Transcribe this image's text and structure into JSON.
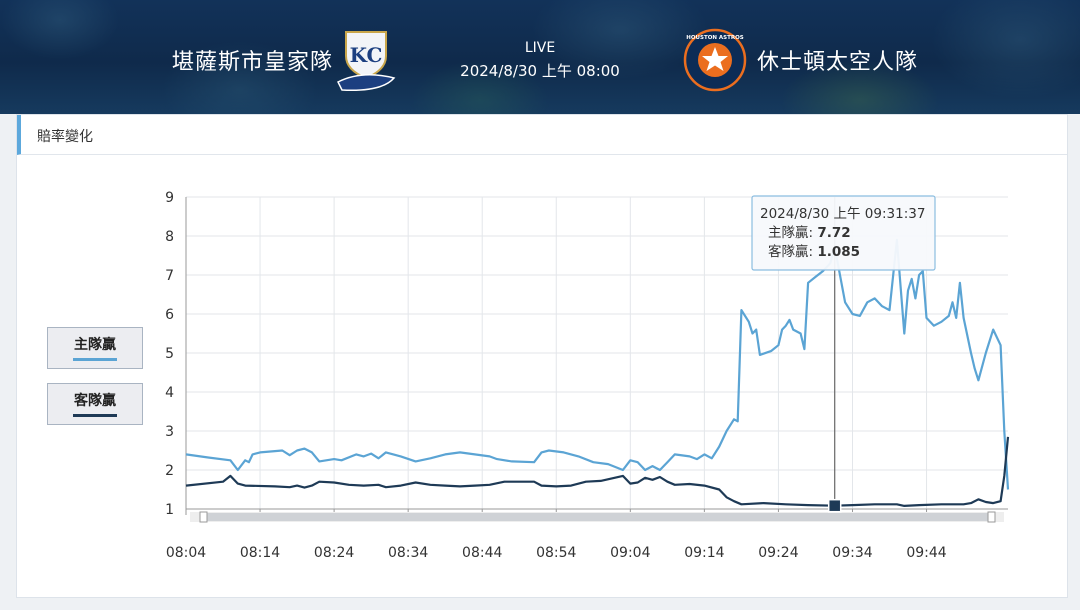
{
  "header": {
    "home_team": "堪薩斯市皇家隊",
    "away_team": "休士頓太空人隊",
    "status": "LIVE",
    "datetime": "2024/8/30 上午 08:00",
    "home_logo_text": "KC",
    "away_logo_text": "HOUSTON ASTROS"
  },
  "panel": {
    "title": "賠率變化"
  },
  "legend": [
    {
      "label": "主隊贏",
      "color": "#5ba4d4"
    },
    {
      "label": "客隊贏",
      "color": "#1e3a56"
    }
  ],
  "tooltip": {
    "time": "2024/8/30 上午 09:31:37",
    "home_label": "主隊贏",
    "home_value": "7.72",
    "away_label": "客隊贏",
    "away_value": "1.085"
  },
  "chart_data": {
    "type": "line",
    "title": "",
    "xlabel": "",
    "ylabel": "",
    "ylim": [
      1,
      9
    ],
    "yticks": [
      1,
      2,
      3,
      4,
      5,
      6,
      7,
      8,
      9
    ],
    "xticks": [
      "08:04",
      "08:14",
      "08:24",
      "08:34",
      "08:44",
      "08:54",
      "09:04",
      "09:14",
      "09:24",
      "09:34",
      "09:44"
    ],
    "grid": true,
    "legend_position": "left",
    "crosshair_time": "09:31.6",
    "series": [
      {
        "name": "主隊贏",
        "color": "#5ba4d4",
        "points": [
          [
            "08:04",
            2.4
          ],
          [
            "08:07",
            2.32
          ],
          [
            "08:10",
            2.25
          ],
          [
            "08:11",
            2.0
          ],
          [
            "08:12",
            2.25
          ],
          [
            "08:12.5",
            2.2
          ],
          [
            "08:13",
            2.4
          ],
          [
            "08:14",
            2.45
          ],
          [
            "08:17",
            2.5
          ],
          [
            "08:18",
            2.38
          ],
          [
            "08:19",
            2.5
          ],
          [
            "08:20",
            2.55
          ],
          [
            "08:21",
            2.45
          ],
          [
            "08:22",
            2.22
          ],
          [
            "08:24",
            2.28
          ],
          [
            "08:25",
            2.25
          ],
          [
            "08:27",
            2.4
          ],
          [
            "08:28",
            2.35
          ],
          [
            "08:29",
            2.42
          ],
          [
            "08:30",
            2.3
          ],
          [
            "08:31",
            2.45
          ],
          [
            "08:32",
            2.4
          ],
          [
            "08:33",
            2.35
          ],
          [
            "08:35",
            2.22
          ],
          [
            "08:37",
            2.3
          ],
          [
            "08:39",
            2.4
          ],
          [
            "08:41",
            2.45
          ],
          [
            "08:43",
            2.4
          ],
          [
            "08:45",
            2.35
          ],
          [
            "08:46",
            2.28
          ],
          [
            "08:48",
            2.22
          ],
          [
            "08:51",
            2.2
          ],
          [
            "08:52",
            2.45
          ],
          [
            "08:53",
            2.5
          ],
          [
            "08:55",
            2.45
          ],
          [
            "08:57",
            2.35
          ],
          [
            "08:59",
            2.2
          ],
          [
            "09:01",
            2.15
          ],
          [
            "09:03",
            2.0
          ],
          [
            "09:04",
            2.25
          ],
          [
            "09:05",
            2.2
          ],
          [
            "09:06",
            2.0
          ],
          [
            "09:07",
            2.1
          ],
          [
            "09:08",
            2.0
          ],
          [
            "09:09",
            2.2
          ],
          [
            "09:10",
            2.4
          ],
          [
            "09:12",
            2.35
          ],
          [
            "09:13",
            2.28
          ],
          [
            "09:14",
            2.4
          ],
          [
            "09:15",
            2.3
          ],
          [
            "09:16",
            2.6
          ],
          [
            "09:17",
            3.0
          ],
          [
            "09:18",
            3.3
          ],
          [
            "09:18.5",
            3.25
          ],
          [
            "09:19",
            6.1
          ],
          [
            "09:20",
            5.8
          ],
          [
            "09:20.5",
            5.5
          ],
          [
            "09:21",
            5.6
          ],
          [
            "09:21.5",
            4.95
          ],
          [
            "09:23",
            5.05
          ],
          [
            "09:24",
            5.2
          ],
          [
            "09:24.5",
            5.6
          ],
          [
            "09:25",
            5.7
          ],
          [
            "09:25.5",
            5.85
          ],
          [
            "09:26",
            5.6
          ],
          [
            "09:27",
            5.5
          ],
          [
            "09:27.5",
            5.1
          ],
          [
            "09:28",
            6.8
          ],
          [
            "09:29",
            6.95
          ],
          [
            "09:30",
            7.1
          ],
          [
            "09:31",
            7.3
          ],
          [
            "09:31.6",
            7.72
          ],
          [
            "09:33",
            6.3
          ],
          [
            "09:34",
            6.0
          ],
          [
            "09:35",
            5.95
          ],
          [
            "09:36",
            6.3
          ],
          [
            "09:37",
            6.4
          ],
          [
            "09:38",
            6.2
          ],
          [
            "09:39",
            6.1
          ],
          [
            "09:40",
            7.9
          ],
          [
            "09:41",
            5.5
          ],
          [
            "09:41.5",
            6.6
          ],
          [
            "09:42",
            6.9
          ],
          [
            "09:42.5",
            6.4
          ],
          [
            "09:43",
            7.0
          ],
          [
            "09:43.5",
            7.1
          ],
          [
            "09:44",
            5.9
          ],
          [
            "09:45",
            5.7
          ],
          [
            "09:46",
            5.8
          ],
          [
            "09:47",
            5.95
          ],
          [
            "09:47.5",
            6.3
          ],
          [
            "09:48",
            5.9
          ],
          [
            "09:48.5",
            6.8
          ],
          [
            "09:49",
            5.9
          ],
          [
            "09:50",
            5.0
          ],
          [
            "09:50.5",
            4.6
          ],
          [
            "09:51",
            4.3
          ],
          [
            "09:52",
            5.0
          ],
          [
            "09:53",
            5.6
          ],
          [
            "09:54",
            5.2
          ],
          [
            "09:54.5",
            3.0
          ],
          [
            "09:55",
            1.5
          ]
        ]
      },
      {
        "name": "客隊贏",
        "color": "#1e3a56",
        "points": [
          [
            "08:04",
            1.6
          ],
          [
            "08:09",
            1.7
          ],
          [
            "08:10",
            1.85
          ],
          [
            "08:11",
            1.65
          ],
          [
            "08:12",
            1.6
          ],
          [
            "08:16",
            1.58
          ],
          [
            "08:18",
            1.56
          ],
          [
            "08:19",
            1.6
          ],
          [
            "08:20",
            1.55
          ],
          [
            "08:21",
            1.6
          ],
          [
            "08:22",
            1.7
          ],
          [
            "08:24",
            1.68
          ],
          [
            "08:26",
            1.62
          ],
          [
            "08:28",
            1.6
          ],
          [
            "08:30",
            1.62
          ],
          [
            "08:31",
            1.56
          ],
          [
            "08:33",
            1.6
          ],
          [
            "08:35",
            1.68
          ],
          [
            "08:37",
            1.62
          ],
          [
            "08:39",
            1.6
          ],
          [
            "08:41",
            1.58
          ],
          [
            "08:43",
            1.6
          ],
          [
            "08:45",
            1.62
          ],
          [
            "08:47",
            1.7
          ],
          [
            "08:51",
            1.7
          ],
          [
            "08:52",
            1.6
          ],
          [
            "08:54",
            1.58
          ],
          [
            "08:56",
            1.6
          ],
          [
            "08:58",
            1.7
          ],
          [
            "09:00",
            1.72
          ],
          [
            "09:03",
            1.85
          ],
          [
            "09:04",
            1.65
          ],
          [
            "09:05",
            1.68
          ],
          [
            "09:06",
            1.8
          ],
          [
            "09:07",
            1.75
          ],
          [
            "09:08",
            1.82
          ],
          [
            "09:09",
            1.7
          ],
          [
            "09:10",
            1.62
          ],
          [
            "09:12",
            1.64
          ],
          [
            "09:14",
            1.6
          ],
          [
            "09:16",
            1.5
          ],
          [
            "09:17",
            1.3
          ],
          [
            "09:18",
            1.2
          ],
          [
            "09:19",
            1.12
          ],
          [
            "09:22",
            1.15
          ],
          [
            "09:25",
            1.12
          ],
          [
            "09:28",
            1.1
          ],
          [
            "09:31.6",
            1.085
          ],
          [
            "09:34",
            1.1
          ],
          [
            "09:37",
            1.12
          ],
          [
            "09:40",
            1.12
          ],
          [
            "09:41",
            1.08
          ],
          [
            "09:43",
            1.1
          ],
          [
            "09:46",
            1.12
          ],
          [
            "09:49",
            1.12
          ],
          [
            "09:50",
            1.15
          ],
          [
            "09:51",
            1.25
          ],
          [
            "09:52",
            1.18
          ],
          [
            "09:53",
            1.15
          ],
          [
            "09:54",
            1.2
          ],
          [
            "09:54.5",
            1.85
          ],
          [
            "09:55",
            2.85
          ]
        ]
      }
    ]
  }
}
